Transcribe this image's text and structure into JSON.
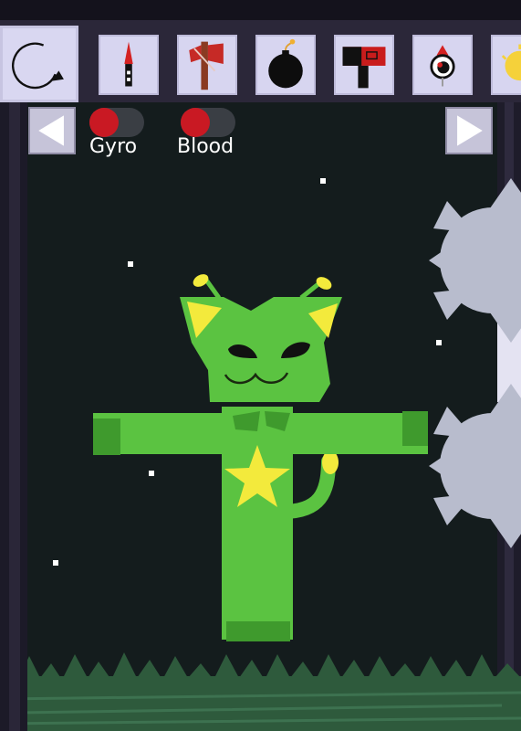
{
  "toolbar": {
    "slots": [
      {
        "name": "reset-icon"
      },
      {
        "name": "knife-icon"
      },
      {
        "name": "axe-icon"
      },
      {
        "name": "bomb-icon"
      },
      {
        "name": "hammer-icon"
      },
      {
        "name": "eye-icon"
      },
      {
        "name": "sun-icon"
      }
    ]
  },
  "nav": {
    "prev_icon": "arrow-left-icon",
    "next_icon": "arrow-right-icon"
  },
  "toggles": {
    "gyro": {
      "label": "Gyro",
      "on": false
    },
    "blood": {
      "label": "Blood",
      "on": false
    }
  },
  "colors": {
    "background": "#141c1d",
    "toolbar": "#2b2739",
    "slot": "#d7d5f0",
    "toggle_knob": "#c91923",
    "character_body": "#5bc341",
    "character_dark": "#3f9a2d",
    "star": "#f3ea3c",
    "grass": "#2e5a3c",
    "spike_ball": "#b8bccd"
  },
  "scene": {
    "character": "green-cat-ragdoll",
    "hazards": [
      "spike-ball",
      "spike-ball"
    ]
  }
}
